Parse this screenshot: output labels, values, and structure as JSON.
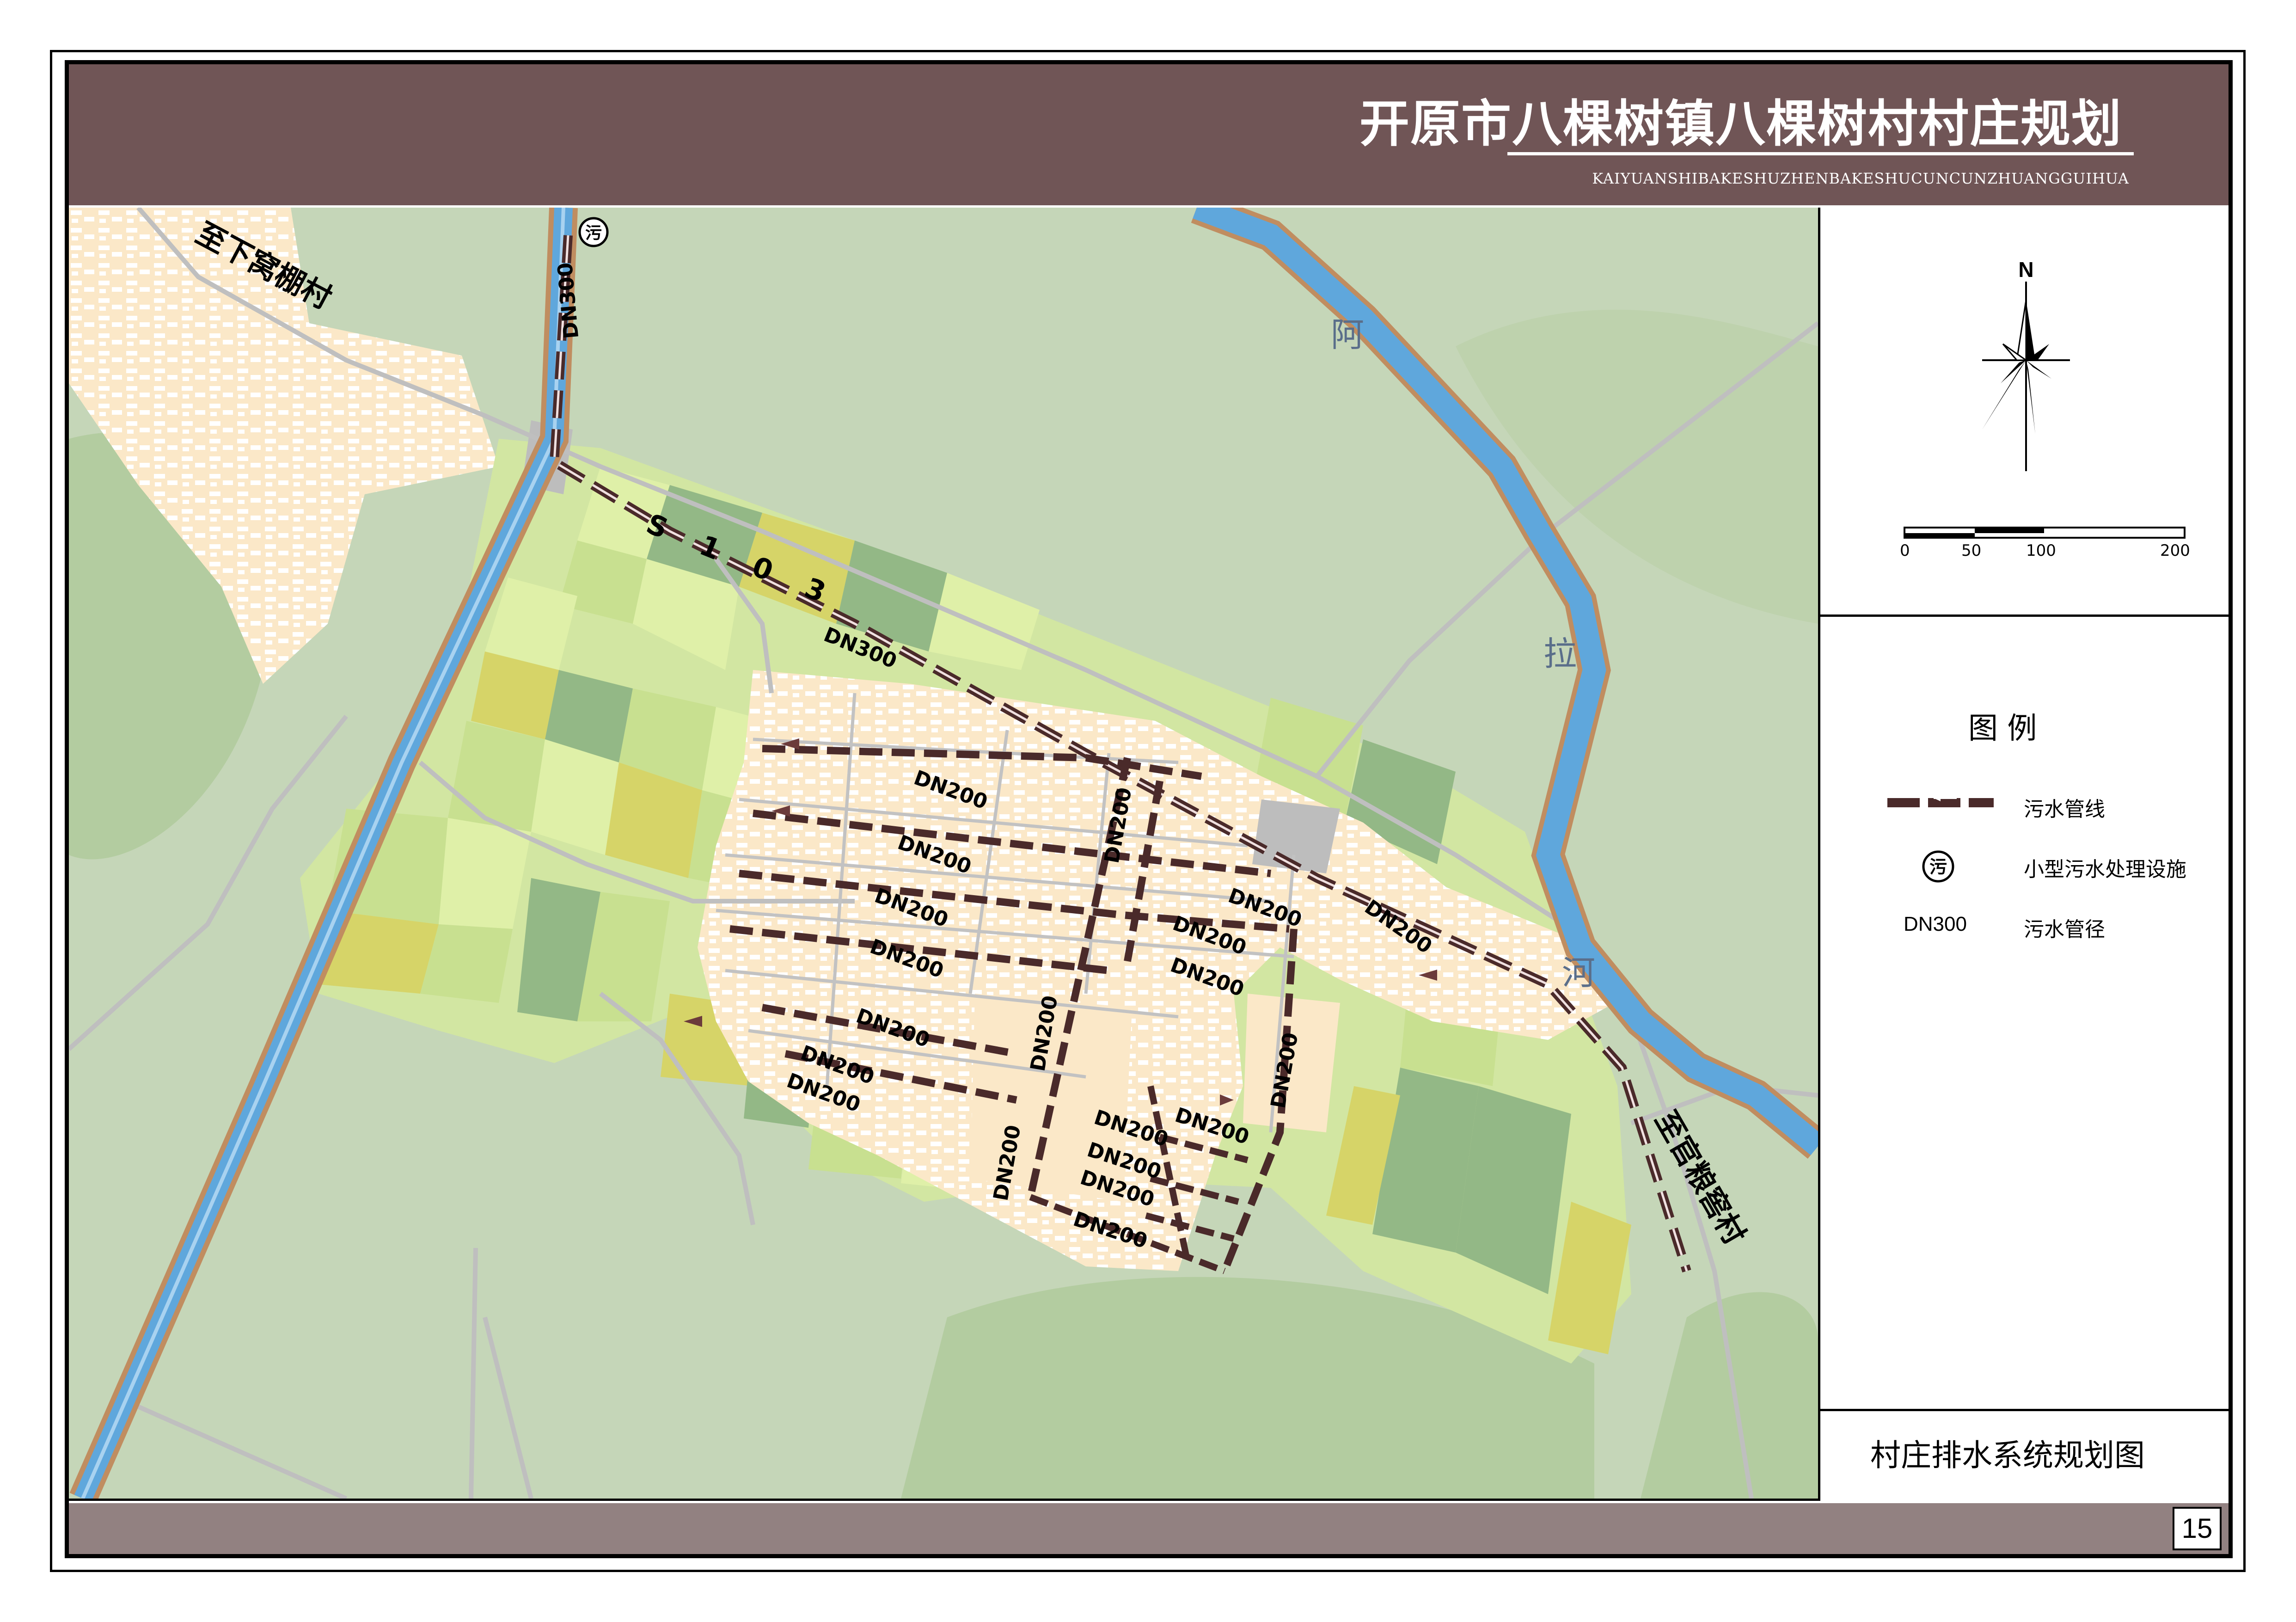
{
  "header": {
    "title": "开原市八棵树镇八棵树村村庄规划",
    "subtitle": "KAIYUANSHIBAKESHUZHENBAKESHUCUNCUNZHUANGGUIHUA"
  },
  "map": {
    "road_labels": {
      "to_north_village": "至下窝棚村",
      "to_south_village": "至官粮窖村",
      "highway": "S 1 0 3"
    },
    "river_label_chars": [
      "阿",
      "拉",
      "河"
    ],
    "facility_symbol": "污",
    "pipe_labels": {
      "dn300": "DN300",
      "dn200": "DN200"
    },
    "colors": {
      "background_green": "#c5d6b8",
      "hill_green": "#b3cca0",
      "village_fill": "#fbe8c8",
      "field_yellow": "#d6d468",
      "field_light": "#dff0a8",
      "field_green": "#c8e090",
      "field_dark": "#93b886",
      "river_blue": "#5fa7dc",
      "river_bank": "#c08d60",
      "road_gray": "#bfbfbf",
      "pipe_color": "#4a2a2a",
      "header_brown": "#705556",
      "footer_brown": "#928181"
    }
  },
  "compass": {
    "north_label": "N"
  },
  "scale_bar": {
    "labels": [
      "0",
      "50",
      "100",
      "200"
    ]
  },
  "legend": {
    "title": "图   例",
    "items": [
      {
        "icon": "sewage-pipe-line-icon",
        "label": "污水管线"
      },
      {
        "icon": "treatment-facility-icon",
        "symbol": "污",
        "label": "小型污水处理设施"
      },
      {
        "icon": "pipe-diameter-icon",
        "symbol": "DN300",
        "label": "污水管径"
      }
    ]
  },
  "drawing_title": "村庄排水系统规划图",
  "page_number": "15"
}
